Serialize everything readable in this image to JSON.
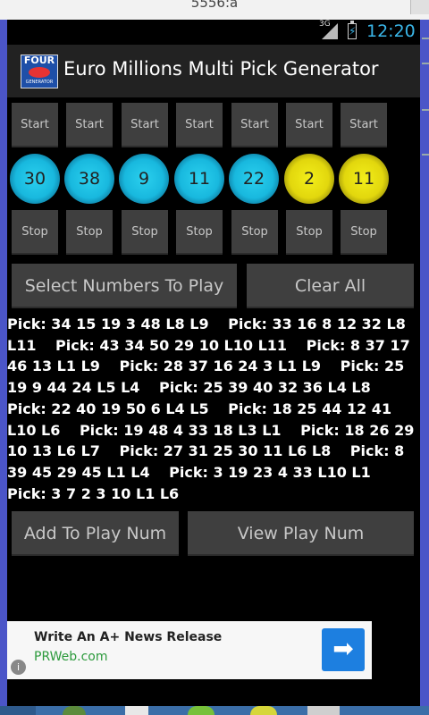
{
  "window": {
    "title": "5556:a"
  },
  "status_bar": {
    "network": "3G",
    "time": "12:20"
  },
  "app": {
    "title": "Euro Millions Multi Pick Generator",
    "logo_top": "FOUR",
    "logo_bottom": "GENERATOR"
  },
  "start_label": "Start",
  "stop_label": "Stop",
  "balls": [
    {
      "value": "30",
      "color": "blue"
    },
    {
      "value": "38",
      "color": "blue"
    },
    {
      "value": "9",
      "color": "blue"
    },
    {
      "value": "11",
      "color": "blue"
    },
    {
      "value": "22",
      "color": "blue"
    },
    {
      "value": "2",
      "color": "yellow"
    },
    {
      "value": "11",
      "color": "yellow"
    }
  ],
  "buttons": {
    "select": "Select Numbers To Play",
    "clear": "Clear All",
    "add": "Add To Play Num",
    "view": "View Play Num"
  },
  "picks": [
    "Pick: 34 15 19 3 48 L8 L9",
    "Pick: 33 16 8 12 32 L8 L11",
    "Pick: 43 34 50 29 10 L10 L11",
    "Pick: 8 37 17 46 13 L1 L9",
    "Pick: 28 37 16 24 3 L1 L9",
    "Pick: 25 19 9 44 24 L5 L4",
    "Pick: 25 39 40 32 36 L4 L8",
    "Pick: 22 40 19 50 6 L4 L5",
    "Pick: 18 25 44 12 41 L10 L6",
    "Pick: 19 48 4 33 18 L3 L1",
    "Pick: 18 26 29 10 13 L6 L7",
    "Pick: 27 31 25 30 11 L6 L8",
    "Pick: 8 39 45 29 45 L1 L4",
    "Pick: 3 19 23 4 33 L10 L1",
    "Pick: 3 7 2 3 10 L1 L6"
  ],
  "ad": {
    "headline": "Write An A+ News Release",
    "url": "PRWeb.com",
    "info": "i",
    "arrow_icon": "arrow-right-icon"
  },
  "colors": {
    "accent": "#3ab6e8",
    "button": "#3f3f3f",
    "ball_blue": "#18b8de",
    "ball_yellow": "#e2d70d"
  }
}
